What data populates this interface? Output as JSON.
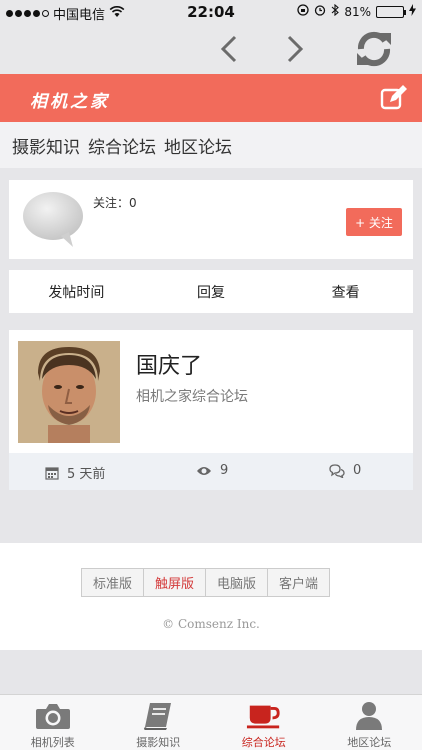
{
  "status_bar": {
    "carrier": "中国电信",
    "time": "22:04",
    "battery": "81%",
    "battery_level": 0.81
  },
  "header": {
    "brand": "相机之家"
  },
  "categories": [
    "摄影知识",
    "综合论坛",
    "地区论坛"
  ],
  "forum_info": {
    "follow_count": "关注：0",
    "follow_button": "+ 关注"
  },
  "sort_bar": [
    "发帖时间",
    "回复",
    "查看"
  ],
  "post": {
    "title": "国庆了",
    "forum": "相机之家综合论坛",
    "time": "5 天前",
    "views": "9",
    "replies": "0"
  },
  "footer": {
    "versions": [
      "标准版",
      "触屏版",
      "电脑版",
      "客户端"
    ],
    "active_version": "触屏版",
    "copyright": "© Comsenz Inc."
  },
  "tab_bar": {
    "items": [
      {
        "label": "相机列表",
        "icon": "camera-icon"
      },
      {
        "label": "摄影知识",
        "icon": "book-icon"
      },
      {
        "label": "综合论坛",
        "icon": "coffee-cup-icon"
      },
      {
        "label": "地区论坛",
        "icon": "user-icon"
      }
    ],
    "active": "综合论坛"
  },
  "colors": {
    "accent": "#f26b5b",
    "active_tab": "#c8241e"
  }
}
